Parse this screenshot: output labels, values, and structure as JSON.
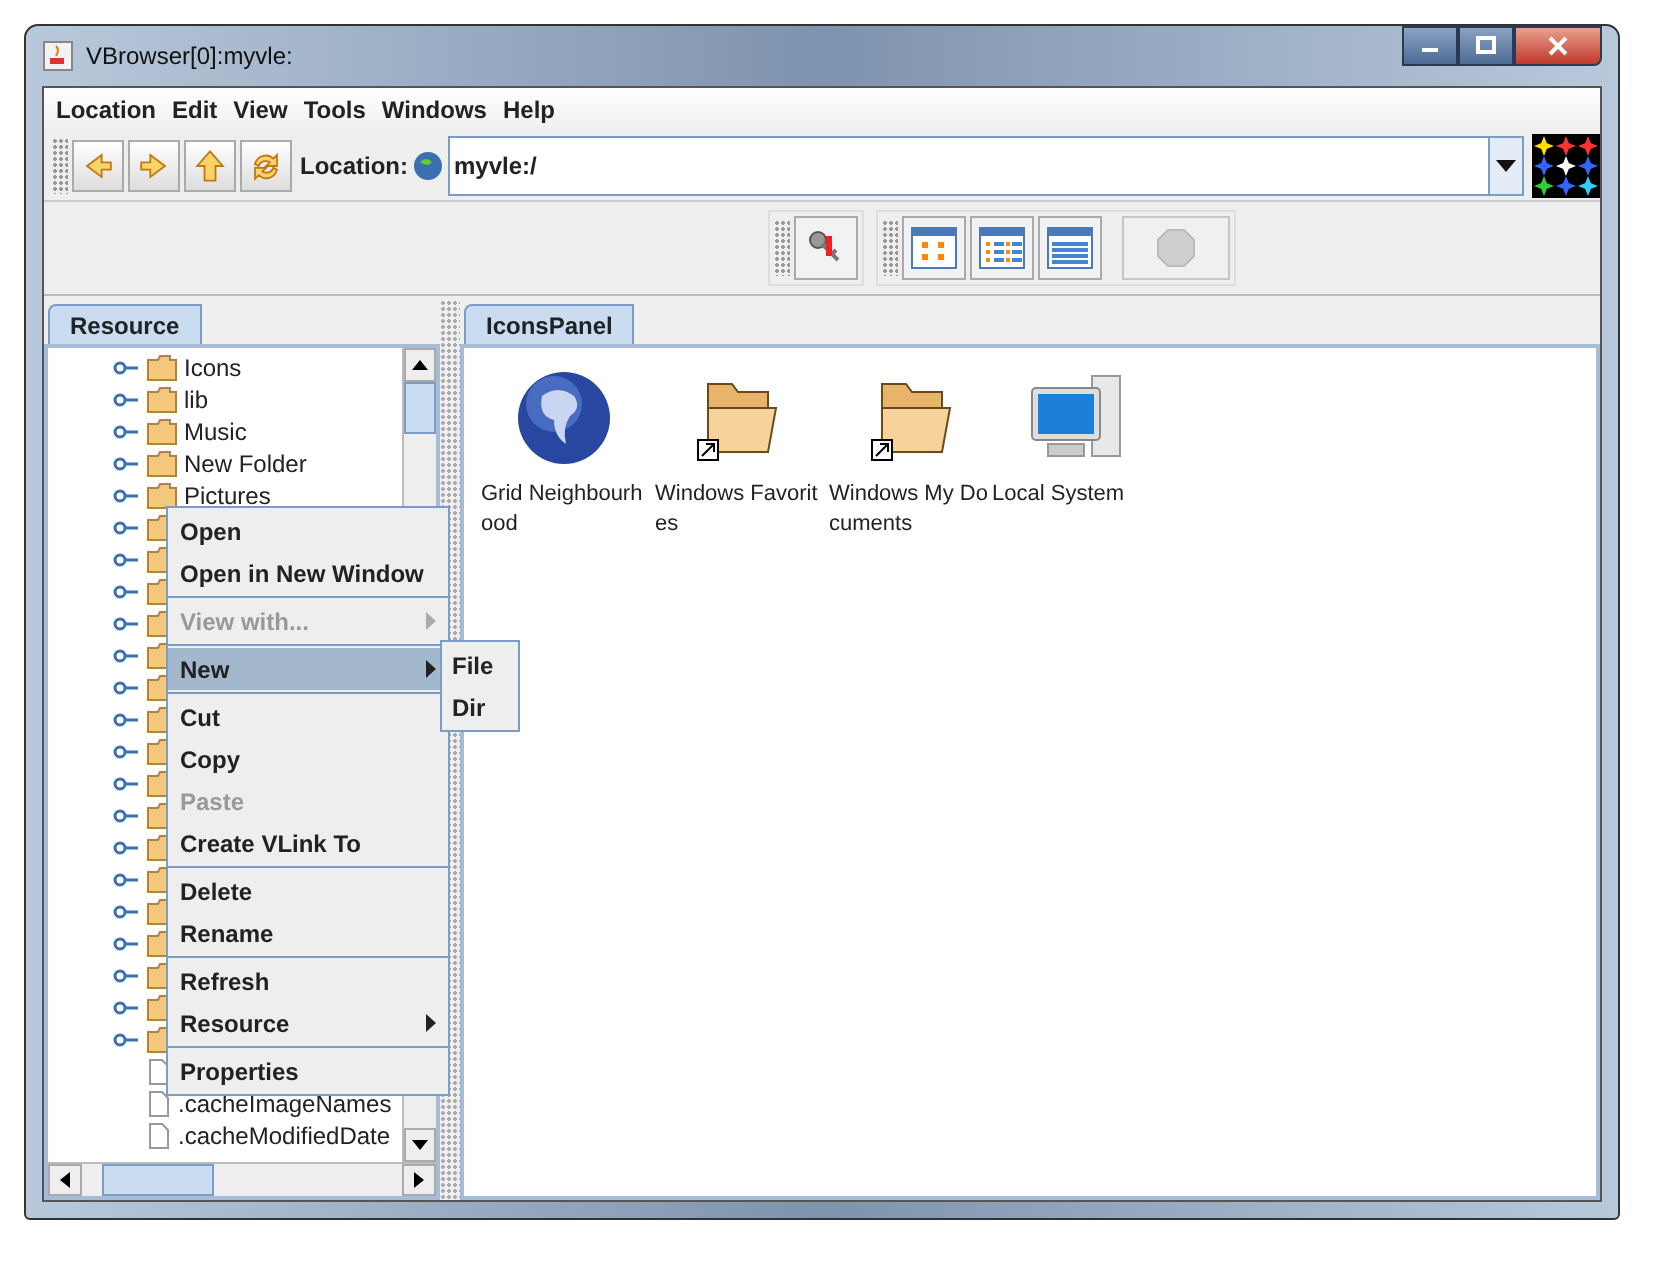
{
  "window": {
    "title": "VBrowser[0]:myvle:"
  },
  "menubar": [
    {
      "label": "Location"
    },
    {
      "label": "Edit"
    },
    {
      "label": "View"
    },
    {
      "label": "Tools"
    },
    {
      "label": "Windows"
    },
    {
      "label": "Help"
    }
  ],
  "nav_toolbar": {
    "buttons": [
      {
        "kind": "back"
      },
      {
        "kind": "forward"
      },
      {
        "kind": "up"
      },
      {
        "kind": "refresh"
      }
    ],
    "location_label": "Location:",
    "location_value": "myvle:/"
  },
  "view_toolbar": {
    "buttons": [
      {
        "kind": "key",
        "disabled": false
      },
      {
        "kind": "icons",
        "disabled": false
      },
      {
        "kind": "list",
        "disabled": false
      },
      {
        "kind": "table",
        "disabled": false
      },
      {
        "kind": "stop",
        "disabled": true
      }
    ]
  },
  "left_panel": {
    "tab": {
      "label": "Resource",
      "selected": true
    },
    "tree": [
      {
        "kind": "folder",
        "label": "Icons"
      },
      {
        "kind": "folder",
        "label": "lib"
      },
      {
        "kind": "folder",
        "label": "Music"
      },
      {
        "kind": "folder",
        "label": "New Folder"
      },
      {
        "kind": "folder",
        "label": "Pictures"
      },
      {
        "kind": "folder"
      },
      {
        "kind": "folder"
      },
      {
        "kind": "folder"
      },
      {
        "kind": "folder"
      },
      {
        "kind": "folder"
      },
      {
        "kind": "folder"
      },
      {
        "kind": "folder"
      },
      {
        "kind": "folder"
      },
      {
        "kind": "folder"
      },
      {
        "kind": "folder"
      },
      {
        "kind": "folder"
      },
      {
        "kind": "folder"
      },
      {
        "kind": "folder"
      },
      {
        "kind": "folder"
      },
      {
        "kind": "folder"
      },
      {
        "kind": "folder"
      },
      {
        "kind": "folder"
      },
      {
        "kind": "file"
      },
      {
        "kind": "file",
        "label": ".cacheImageNames"
      },
      {
        "kind": "file",
        "label": ".cacheModifiedDate"
      }
    ]
  },
  "right_panel": {
    "tab": {
      "label": "IconsPanel",
      "selected": true
    },
    "icons": [
      {
        "kind": "globe",
        "label": "Grid Neighbourhood"
      },
      {
        "kind": "folder_link",
        "label": "Windows Favorites"
      },
      {
        "kind": "folder_link",
        "label": "Windows My Documents"
      },
      {
        "kind": "computer",
        "label": "Local System"
      }
    ]
  },
  "context_menu": {
    "groups": [
      [
        {
          "label": "Open",
          "disabled": false,
          "selected": false,
          "submenu": false
        },
        {
          "label": "Open in New Window",
          "disabled": false,
          "selected": false,
          "submenu": false
        }
      ],
      [
        {
          "label": "View with...",
          "disabled": true,
          "selected": false,
          "submenu": true
        }
      ],
      [
        {
          "label": "New",
          "disabled": false,
          "selected": true,
          "submenu": true
        }
      ],
      [
        {
          "label": "Cut",
          "disabled": false,
          "selected": false,
          "submenu": false
        },
        {
          "label": "Copy",
          "disabled": false,
          "selected": false,
          "submenu": false
        },
        {
          "label": "Paste",
          "disabled": true,
          "selected": false,
          "submenu": false
        },
        {
          "label": "Create VLink To",
          "disabled": false,
          "selected": false,
          "submenu": false
        }
      ],
      [
        {
          "label": "Delete",
          "disabled": false,
          "selected": false,
          "submenu": false
        },
        {
          "label": "Rename",
          "disabled": false,
          "selected": false,
          "submenu": false
        }
      ],
      [
        {
          "label": "Refresh",
          "disabled": false,
          "selected": false,
          "submenu": false
        },
        {
          "label": "Resource",
          "disabled": false,
          "selected": false,
          "submenu": true
        }
      ],
      [
        {
          "label": "Properties",
          "disabled": false,
          "selected": false,
          "submenu": false
        }
      ]
    ]
  },
  "submenu": {
    "items": [
      {
        "label": "File"
      },
      {
        "label": "Dir"
      }
    ]
  }
}
